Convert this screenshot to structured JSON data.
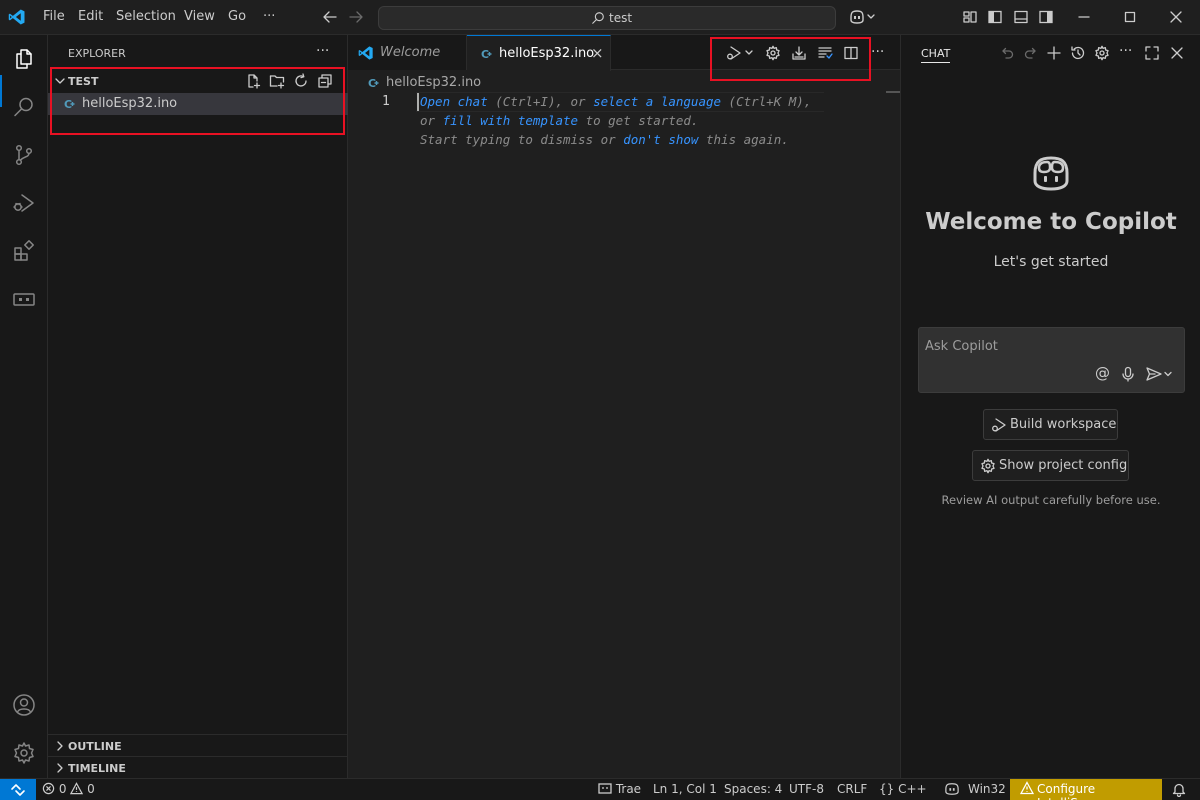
{
  "titlebar": {
    "menus": [
      "File",
      "Edit",
      "Selection",
      "View",
      "Go",
      "···"
    ],
    "search_text": "test"
  },
  "sidebar": {
    "title": "EXPLORER",
    "more": "···",
    "folder_name": "TEST",
    "files": [
      {
        "name": "helloEsp32.ino"
      }
    ],
    "sections": [
      {
        "label": "OUTLINE"
      },
      {
        "label": "TIMELINE"
      }
    ]
  },
  "editor": {
    "tabs": [
      {
        "label": "Welcome",
        "active": false
      },
      {
        "label": "helloEsp32.ino",
        "active": true,
        "close": "×"
      }
    ],
    "more": "···",
    "breadcrumb": "helloEsp32.ino",
    "line_number": "1",
    "hint": {
      "line1": {
        "a": "Open chat",
        "b": " (Ctrl+I), or ",
        "c": "select a language",
        "d": " (Ctrl+K M),"
      },
      "line2": {
        "a": "or ",
        "b": "fill with template",
        "c": " to get started."
      },
      "line3": {
        "a": "Start typing to dismiss or ",
        "b": "don't show",
        "c": " this again."
      }
    }
  },
  "chat": {
    "title": "CHAT",
    "more": "···",
    "welcome_title": "Welcome to Copilot",
    "welcome_sub": "Let's get started",
    "ask_placeholder": "Ask Copilot",
    "at_symbol": "@",
    "buttons": {
      "build": "Build workspace",
      "config": "Show project config"
    },
    "review_note": "Review AI output carefully before use."
  },
  "statusbar": {
    "errors": "0",
    "warnings": "0",
    "trae": "Trae",
    "position": "Ln 1, Col 1",
    "spaces": "Spaces: 4",
    "encoding": "UTF-8",
    "eol": "CRLF",
    "language_braces": "{}",
    "language": "C++",
    "platform": "Win32",
    "intellisense": "Configure IntelliSense"
  },
  "colors": {
    "accent": "#0078d4",
    "highlight_box": "#e81123",
    "link": "#3794ff",
    "warning_bg": "#c19c00",
    "c_file_icon": "#519aba"
  }
}
